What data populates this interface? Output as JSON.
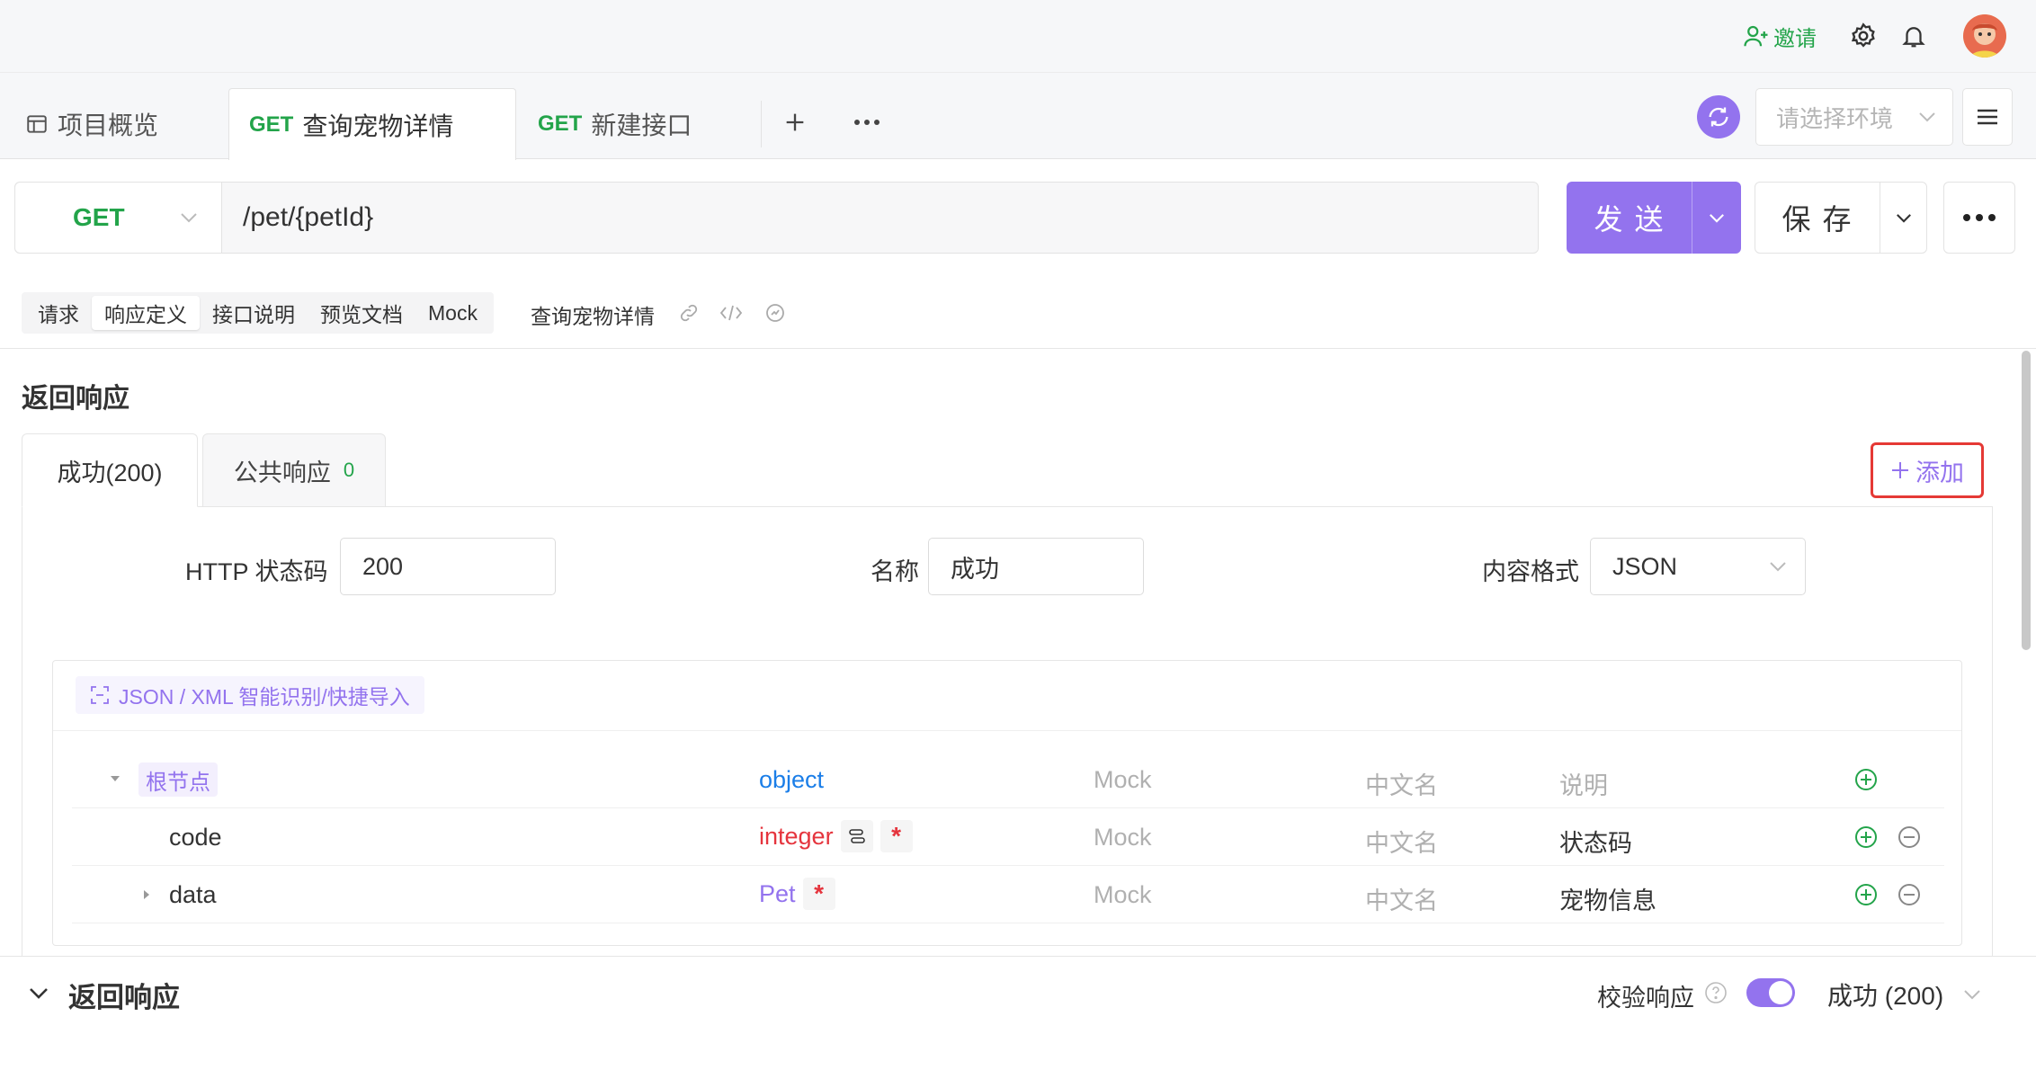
{
  "header": {
    "invite_label": "邀请"
  },
  "tabs": [
    {
      "label": "项目概览"
    },
    {
      "method": "GET",
      "label": "查询宠物详情"
    },
    {
      "method": "GET",
      "label": "新建接口"
    }
  ],
  "env": {
    "placeholder": "请选择环境"
  },
  "request": {
    "method": "GET",
    "url": "/pet/{petId}"
  },
  "actions": {
    "send": "发 送",
    "save": "保 存"
  },
  "subtabs": [
    "请求",
    "响应定义",
    "接口说明",
    "预览文档",
    "Mock"
  ],
  "api_name": "查询宠物详情",
  "section_title": "返回响应",
  "response_tabs": {
    "success": "成功(200)",
    "common": "公共响应",
    "common_count": "0",
    "add": "添加"
  },
  "form": {
    "status_label": "HTTP 状态码",
    "status_value": "200",
    "name_label": "名称",
    "name_value": "成功",
    "format_label": "内容格式",
    "format_value": "JSON"
  },
  "import_label": "JSON / XML 智能识别/快捷导入",
  "schema_rows": [
    {
      "name": "根节点",
      "type": "object",
      "mock": "Mock",
      "cn": "中文名",
      "desc": "说明"
    },
    {
      "name": "code",
      "type": "integer",
      "mock": "Mock",
      "cn": "中文名",
      "desc": "状态码"
    },
    {
      "name": "data",
      "type": "Pet",
      "mock": "Mock",
      "cn": "中文名",
      "desc": "宠物信息"
    }
  ],
  "footer": {
    "title": "返回响应",
    "validate_label": "校验响应",
    "selected": "成功 (200)"
  },
  "colors": {
    "accent": "#9373ee",
    "green": "#23a44a",
    "blue": "#1b7ee8",
    "red": "#e5343d",
    "highlight": "#e53935"
  }
}
